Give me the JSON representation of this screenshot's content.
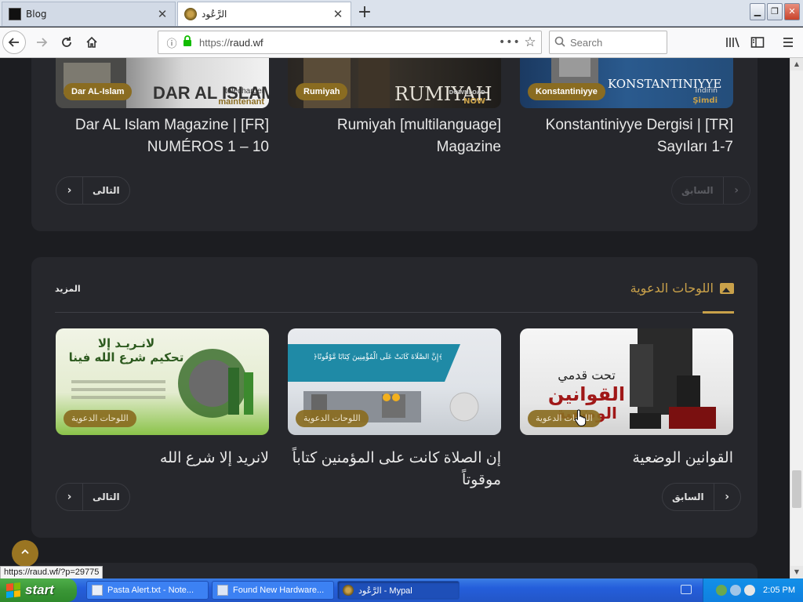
{
  "browser": {
    "tabs": [
      {
        "title": "Blog",
        "active": false
      },
      {
        "title": "الرَّعُود",
        "active": true
      }
    ],
    "url_scheme": "https://",
    "url_host": "raud.wf",
    "search_placeholder": "Search"
  },
  "magazines": [
    {
      "badge": "Konstantiniyye",
      "title": "Konstantiniyye Dergisi | [TR] Sayıları 1-7",
      "cover_title": "KONSTANTINIYYE",
      "cover_tag": "Indirin",
      "cover_tag2": "Şimdi"
    },
    {
      "badge": "Rumiyah",
      "title": "Rumiyah [multilanguage] Magazine",
      "cover_title": "RUMIYAH",
      "cover_tag": "DOWNLOAD",
      "cover_tag2": "NOW"
    },
    {
      "badge": "Dar AL-Islam",
      "title": "Dar AL Islam Magazine | [FR] NUMÉROS 1 – 10",
      "cover_title": "DAR AL ISLAM",
      "cover_tag": "télécharger",
      "cover_tag2": "maintenant"
    }
  ],
  "pager1": {
    "prev": "السابق",
    "next": "التالى"
  },
  "section2": {
    "title": "اللوحات الدعوية",
    "more": "المزيد",
    "cards": [
      {
        "badge": "اللوحات الدعوية",
        "title": "القوانين الوضعية",
        "img_line1": "تحت قدمي",
        "img_line2": "القوانين",
        "img_line3": "الوضعية"
      },
      {
        "badge": "اللوحات الدعوية",
        "title": "إن الصلاة كانت على المؤمنين كتاباً موقوتاً",
        "img_line1": "﴿إِنَّ الصَّلَاةَ كَانَتْ عَلَى الْمُؤْمِنِينَ كِتَابًا مَّوْقُوتًا﴾"
      },
      {
        "badge": "اللوحات الدعوية",
        "title": "لانريد إلا شرع الله",
        "img_line1": "لانـريـد إلا",
        "img_line2": "تحكيم شرع الله فينا"
      }
    ],
    "pager": {
      "prev": "السابق",
      "next": "التالى"
    }
  },
  "status_url": "https://raud.wf/?p=29775",
  "taskbar": {
    "start": "start",
    "tasks": [
      "Pasta Alert.txt - Note...",
      "Found New Hardware...",
      "الرَّعُود - Mypal"
    ],
    "clock": "2:05 PM"
  },
  "colors": {
    "gold": "#c9a14a",
    "badge": "#8a6c21",
    "panel": "#26272c",
    "page_bg": "#1c1d21"
  }
}
